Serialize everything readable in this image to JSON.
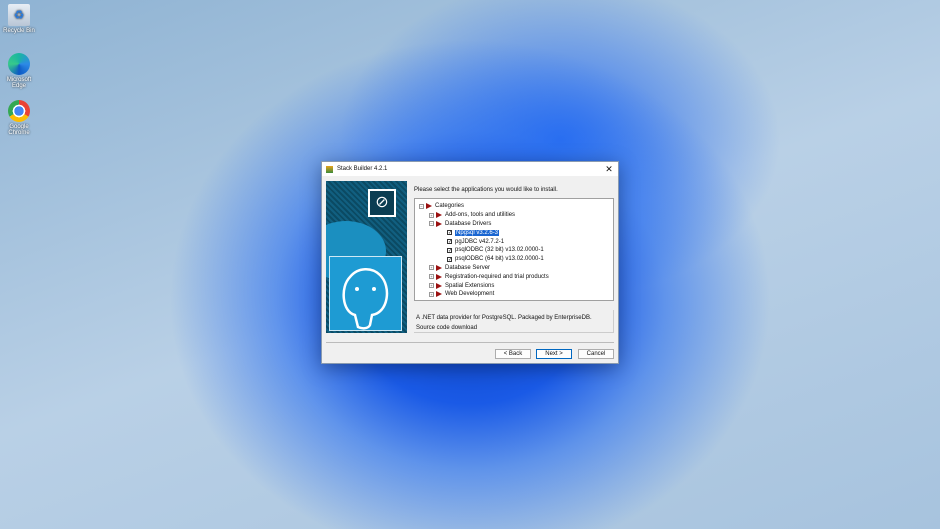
{
  "desktop": {
    "icons": [
      {
        "label": "Recycle Bin",
        "icon": "recycle-bin-icon"
      },
      {
        "label": "Microsoft Edge",
        "icon": "edge-icon"
      },
      {
        "label": "Google Chrome",
        "icon": "chrome-icon"
      }
    ]
  },
  "dialog": {
    "title": "Stack Builder 4.2.1",
    "close": "✕",
    "prompt": "Please select the applications you would like to install.",
    "tree": {
      "root": "Categories",
      "categories": [
        "Add-ons, tools and utilities",
        "Database Drivers",
        "Database Server",
        "Registration-required and trial products",
        "Spatial Extensions",
        "Web Development"
      ],
      "drivers": [
        {
          "label": "Npgsql v3.2.6-3",
          "checked": true,
          "selected": true
        },
        {
          "label": "pgJDBC v42.7.2-1",
          "checked": true
        },
        {
          "label": "psqlODBC (32 bit) v13.02.0000-1",
          "checked": true
        },
        {
          "label": "psqlODBC (64 bit) v13.02.0000-1",
          "checked": true
        }
      ]
    },
    "description": "A .NET data provider for PostgreSQL.  Packaged by EnterpriseDB.",
    "description_link": "Source code download",
    "buttons": {
      "back": "< Back",
      "next": "Next >",
      "cancel": "Cancel"
    }
  }
}
